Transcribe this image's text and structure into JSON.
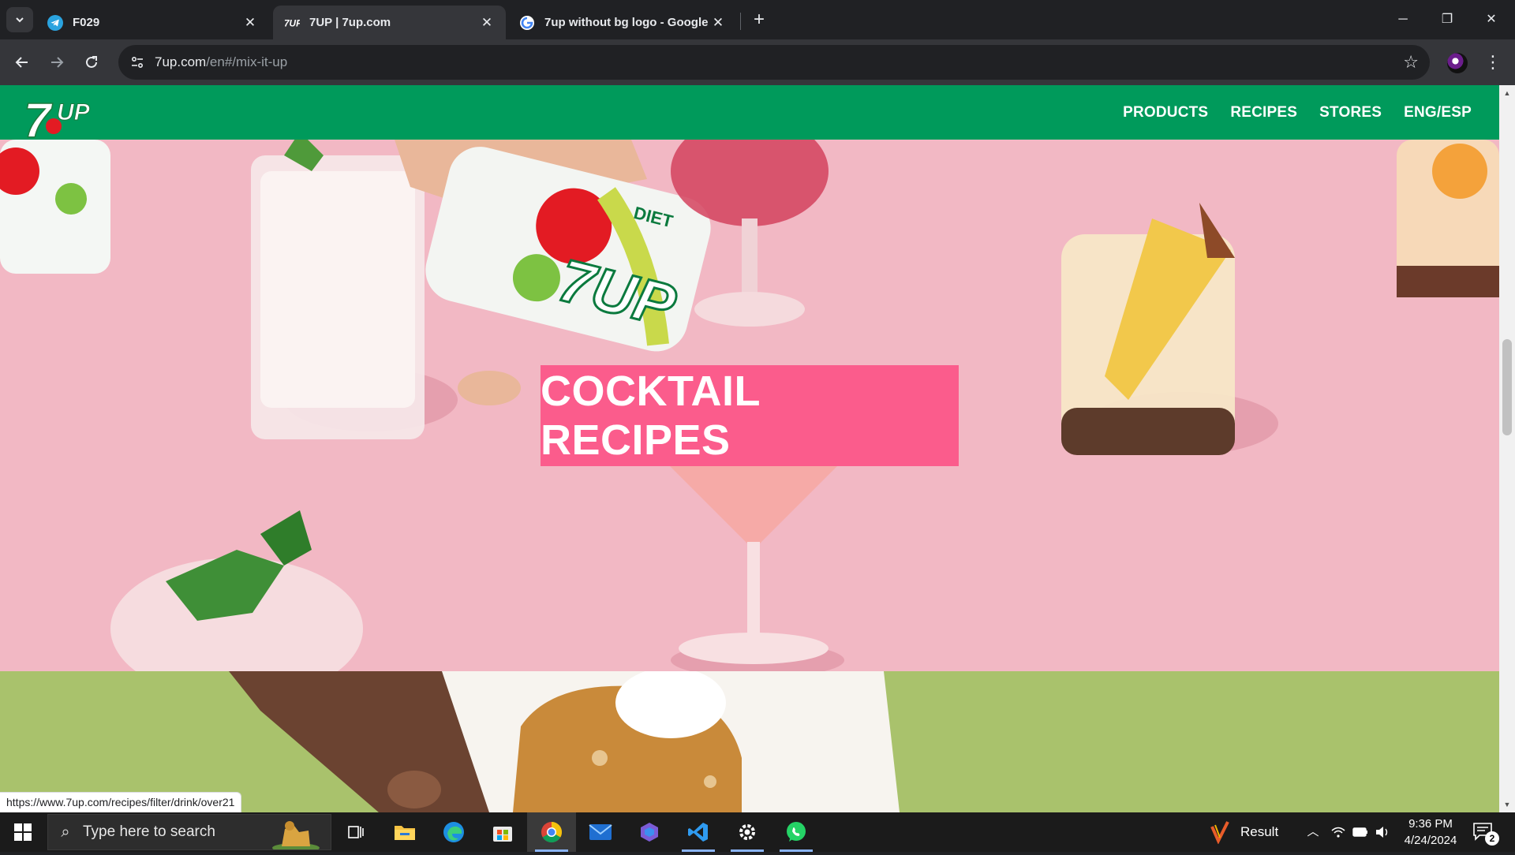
{
  "browser": {
    "tabs": [
      {
        "title": "F029",
        "icon": "telegram-icon",
        "active": false
      },
      {
        "title": "7UP | 7up.com",
        "icon": "7up-favicon",
        "active": true
      },
      {
        "title": "7up without bg logo - Google",
        "icon": "google-icon",
        "active": false
      }
    ],
    "tab_close": "✕",
    "new_tab": "+",
    "url_host": "7up.com",
    "url_path": "/en#/mix-it-up",
    "window_controls": {
      "minimize": "─",
      "restore": "❐",
      "close": "✕"
    }
  },
  "site": {
    "logo_text": "7UP",
    "nav": [
      "PRODUCTS",
      "RECIPES",
      "STORES",
      "ENG/ESP"
    ],
    "hero_cta": "COCKTAIL RECIPES",
    "can_label_top": "DIET",
    "can_label_brand": "7UP",
    "colors": {
      "header_green": "#009a5b",
      "cta_pink": "#fb5c8c",
      "hero_pink": "#f2b8c4",
      "hero2_green": "#a9c26c"
    }
  },
  "status_bar_url": "https://www.7up.com/recipes/filter/drink/over21",
  "taskbar": {
    "search_placeholder": "Type here to search",
    "apps": [
      "task-view-icon",
      "file-explorer-icon",
      "edge-icon",
      "store-icon",
      "chrome-icon",
      "mail-icon",
      "copilot-icon",
      "vscode-icon",
      "settings-icon",
      "whatsapp-icon"
    ],
    "result_label": "Result",
    "time": "9:36 PM",
    "date": "4/24/2024",
    "notification_count": "2"
  }
}
